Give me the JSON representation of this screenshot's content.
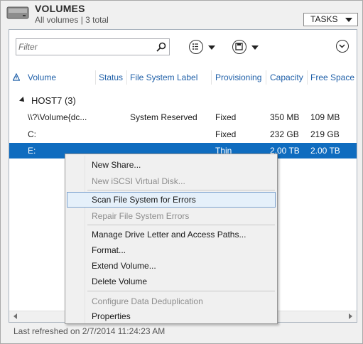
{
  "header": {
    "title": "VOLUMES",
    "subtitle": "All volumes | 3 total",
    "tasks_label": "TASKS"
  },
  "toolbar": {
    "filter_placeholder": "Filter"
  },
  "columns": [
    "Volume",
    "Status",
    "File System Label",
    "Provisioning",
    "Capacity",
    "Free Space"
  ],
  "group": {
    "label": "HOST7 (3)"
  },
  "rows": [
    {
      "volume": "\\\\?\\Volume{dc...",
      "status": "",
      "label": "System Reserved",
      "provisioning": "Fixed",
      "capacity": "350 MB",
      "free": "109 MB"
    },
    {
      "volume": "C:",
      "status": "",
      "label": "",
      "provisioning": "Fixed",
      "capacity": "232 GB",
      "free": "219 GB"
    },
    {
      "volume": "E:",
      "status": "",
      "label": "",
      "provisioning": "Thin",
      "capacity": "2.00 TB",
      "free": "2.00 TB"
    }
  ],
  "context_menu": {
    "new_share": "New Share...",
    "new_iscsi": "New iSCSI Virtual Disk...",
    "scan_errors": "Scan File System for Errors",
    "repair_errors": "Repair File System Errors",
    "manage_drive": "Manage Drive Letter and Access Paths...",
    "format": "Format...",
    "extend": "Extend Volume...",
    "delete": "Delete Volume",
    "dedup": "Configure Data Deduplication",
    "properties": "Properties"
  },
  "status": {
    "last_refreshed": "Last refreshed on 2/7/2014 11:24:23 AM"
  },
  "colors": {
    "selection": "#0f6cbf",
    "header_link": "#1e5fa8",
    "menu_hover": "#e5f0fa"
  }
}
